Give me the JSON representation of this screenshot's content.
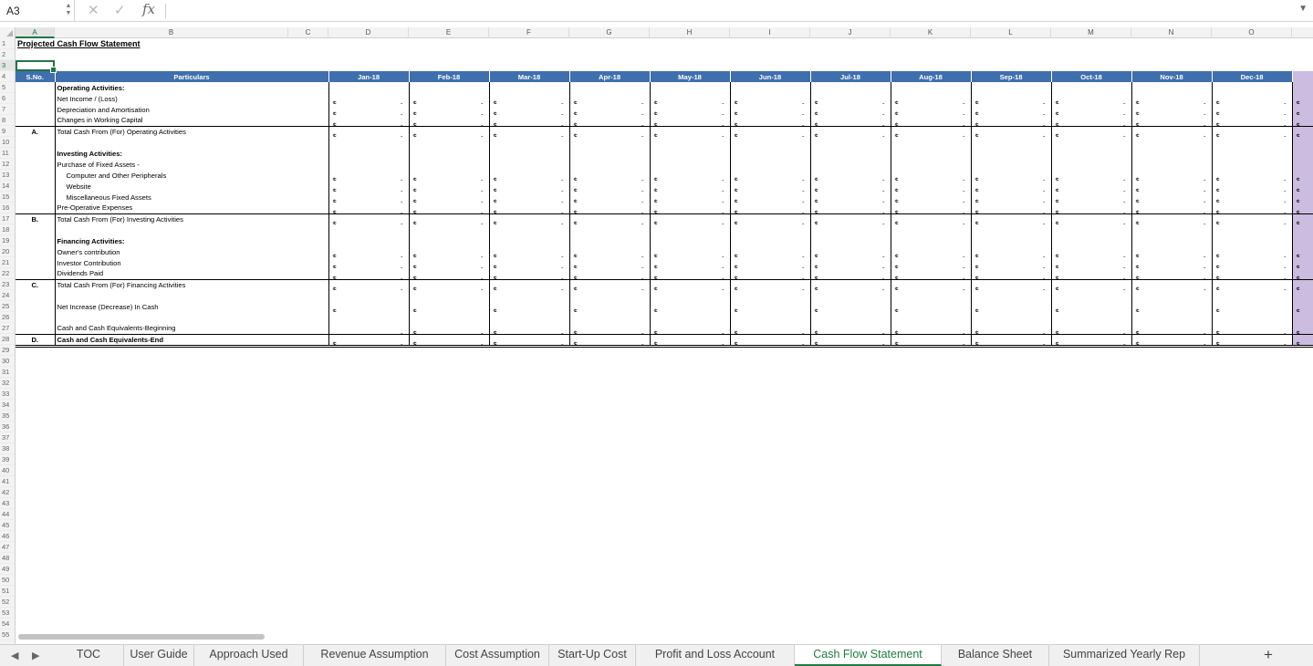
{
  "formula_bar": {
    "name_box": "A3",
    "cancel_icon": "✕",
    "enter_icon": "✓",
    "fx_label": "fx",
    "formula": ""
  },
  "columns": [
    "A",
    "B",
    "C",
    "D",
    "E",
    "F",
    "G",
    "H",
    "I",
    "J",
    "K",
    "L",
    "M",
    "N",
    "O"
  ],
  "selected_column": "A",
  "selected_row": 3,
  "row_numbers": [
    "1",
    "2",
    "3",
    "4",
    "5",
    "6",
    "7",
    "8",
    "9",
    "10",
    "11",
    "12",
    "13",
    "14",
    "15",
    "16",
    "17",
    "18",
    "19",
    "20",
    "21",
    "22",
    "23",
    "24",
    "25",
    "26",
    "27",
    "28",
    "29",
    "30",
    "31",
    "32",
    "33",
    "34",
    "35",
    "36",
    "37",
    "38",
    "39",
    "40",
    "41",
    "42",
    "43",
    "44",
    "45",
    "46",
    "47",
    "48",
    "49",
    "50",
    "51",
    "52",
    "53",
    "54",
    "55"
  ],
  "sheet": {
    "title": "Projected Cash Flow Statement",
    "header": {
      "sno": "S.No.",
      "particulars": "Particulars",
      "months": [
        "Jan-18",
        "Feb-18",
        "Mar-18",
        "Apr-18",
        "May-18",
        "Jun-18",
        "Jul-18",
        "Aug-18",
        "Sep-18",
        "Oct-18",
        "Nov-18",
        "Dec-18"
      ]
    },
    "currency": "$",
    "empty_value": "-",
    "tail_color": "#ccbde0",
    "header_color": "#3f6fad",
    "rows": [
      {
        "r": 5,
        "a": "",
        "b": "Operating Activities:",
        "bold": true,
        "vals": false
      },
      {
        "r": 6,
        "a": "",
        "b": "Net Income / (Loss)",
        "vals": true
      },
      {
        "r": 7,
        "a": "",
        "b": "Depreciation and Amortisation",
        "vals": true
      },
      {
        "r": 8,
        "a": "",
        "b": "Changes in Working Capital",
        "vals": true
      },
      {
        "r": 9,
        "a": "A.",
        "b": "Total Cash From (For) Operating Activities",
        "vals": true,
        "total": true
      },
      {
        "r": 10,
        "a": "",
        "b": "",
        "vals": false,
        "gapbot": false
      },
      {
        "r": 11,
        "a": "",
        "b": "Investing Activities:",
        "bold": true,
        "vals": false
      },
      {
        "r": 12,
        "a": "",
        "b": "Purchase of Fixed Assets -",
        "vals": false
      },
      {
        "r": 13,
        "a": "",
        "b": "Computer and Other Peripherals",
        "indent": true,
        "vals": true
      },
      {
        "r": 14,
        "a": "",
        "b": "Website",
        "indent": true,
        "vals": true
      },
      {
        "r": 15,
        "a": "",
        "b": "Miscellaneous Fixed Assets",
        "indent": true,
        "vals": true
      },
      {
        "r": 16,
        "a": "",
        "b": "Pre-Operative Expenses",
        "vals": true
      },
      {
        "r": 17,
        "a": "B.",
        "b": "Total Cash From (For) Investing Activities",
        "vals": true,
        "total": true
      },
      {
        "r": 18,
        "a": "",
        "b": "",
        "vals": false
      },
      {
        "r": 19,
        "a": "",
        "b": "Financing Activities:",
        "bold": true,
        "vals": false
      },
      {
        "r": 20,
        "a": "",
        "b": "Owner's contribution",
        "vals": true
      },
      {
        "r": 21,
        "a": "",
        "b": "Investor Contribution",
        "vals": true
      },
      {
        "r": 22,
        "a": "",
        "b": "Dividends Paid",
        "vals": true
      },
      {
        "r": 23,
        "a": "C.",
        "b": "Total Cash From (For) Financing Activities",
        "vals": true,
        "total": true
      },
      {
        "r": 24,
        "a": "",
        "b": "",
        "vals": false
      },
      {
        "r": 25,
        "a": "",
        "b": "Net Increase (Decrease) In Cash",
        "vals": "cur"
      },
      {
        "r": 26,
        "a": "",
        "b": "",
        "vals": false
      },
      {
        "r": 27,
        "a": "",
        "b": "Cash and Cash Equivalents-Beginning",
        "vals": "begin"
      },
      {
        "r": 28,
        "a": "D.",
        "b": "Cash and Cash Equivalents-End",
        "bold": true,
        "vals": true,
        "total": true,
        "dbl": true
      }
    ]
  },
  "tabs": [
    "TOC",
    "User Guide",
    "Approach Used",
    "Revenue Assumption",
    "Cost Assumption",
    "Start-Up Cost",
    "Profit and Loss Account",
    "Cash Flow Statement",
    "Balance Sheet",
    "Summarized Yearly Rep"
  ],
  "active_tab": "Cash Flow Statement",
  "add_sheet": "+"
}
